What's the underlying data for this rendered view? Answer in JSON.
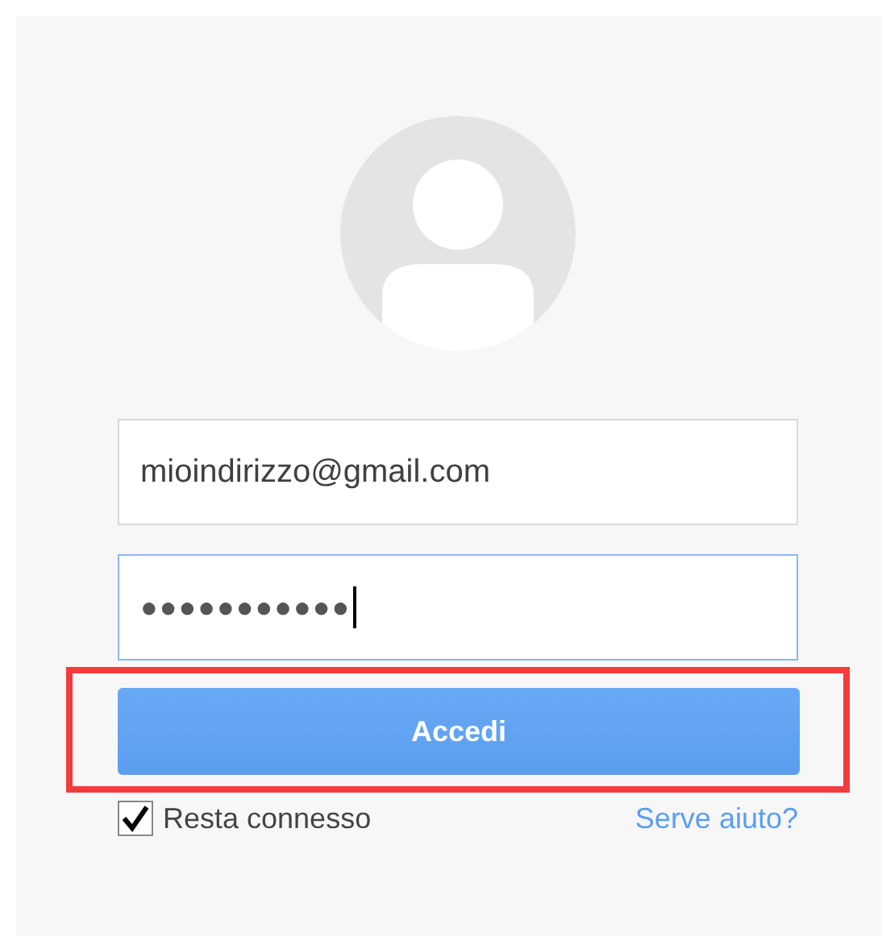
{
  "email_field": {
    "value": "mioindirizzo@gmail.com",
    "focused": false
  },
  "password_field": {
    "value": "●●●●●●●●●●●",
    "focused": true
  },
  "sign_in_button": {
    "label": "Accedi",
    "highlighted": true
  },
  "stay_signed_in": {
    "label": "Resta connesso",
    "checked": true
  },
  "help_link": {
    "label": "Serve aiuto?"
  }
}
